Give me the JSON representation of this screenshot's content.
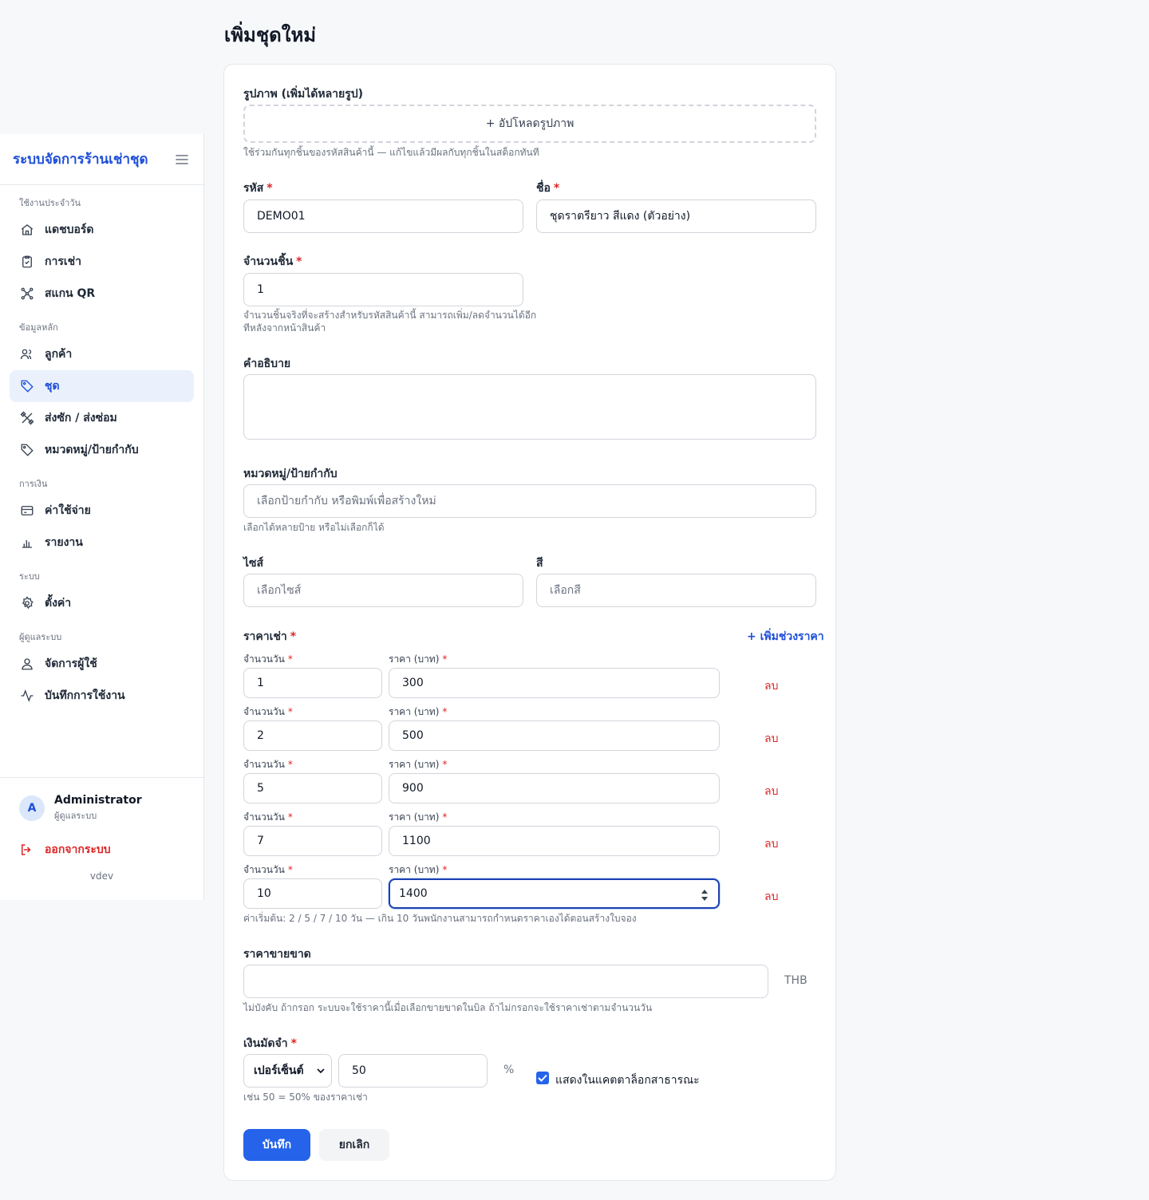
{
  "page": {
    "title": "เพิ่มชุดใหม่"
  },
  "sidebar": {
    "brand": "ระบบจัดการร้านเช่าชุด",
    "sections": [
      {
        "label": "ใช้งานประจำวัน",
        "items": [
          "แดชบอร์ด",
          "การเช่า",
          "สแกน QR"
        ]
      },
      {
        "label": "ข้อมูลหลัก",
        "items": [
          "ลูกค้า",
          "ชุด",
          "ส่งซัก / ส่งซ่อม",
          "หมวดหมู่/ป้ายกำกับ"
        ]
      },
      {
        "label": "การเงิน",
        "items": [
          "ค่าใช้จ่าย",
          "รายงาน"
        ]
      },
      {
        "label": "ระบบ",
        "items": [
          "ตั้งค่า"
        ]
      },
      {
        "label": "ผู้ดูแลระบบ",
        "items": [
          "จัดการผู้ใช้",
          "บันทึกการใช้งาน"
        ]
      }
    ],
    "active_item": "ชุด",
    "user": {
      "initial": "A",
      "name": "Administrator",
      "role": "ผู้ดูแลระบบ"
    },
    "logout": "ออกจากระบบ",
    "version": "vdev"
  },
  "form": {
    "images": {
      "label": "รูปภาพ (เพิ่มได้หลายรูป)",
      "upload_button": "+ อัปโหลดรูปภาพ",
      "hint": "ใช้ร่วมกันทุกชิ้นของรหัสสินค้านี้ — แก้ไขแล้วมีผลกับทุกชิ้นในสต็อกทันที"
    },
    "code": {
      "label": "รหัส",
      "value": "DEMO01"
    },
    "name": {
      "label": "ชื่อ",
      "value": "ชุดราตรียาว สีแดง (ตัวอย่าง)"
    },
    "quantity": {
      "label": "จำนวนชิ้น",
      "value": "1",
      "hint_line1": "จำนวนชิ้นจริงที่จะสร้างสำหรับรหัสสินค้านี้ สามารถเพิ่ม/ลดจำนวนได้อีก",
      "hint_line2": "ทีหลังจากหน้าสินค้า"
    },
    "description": {
      "label": "คำอธิบาย",
      "value": ""
    },
    "tags": {
      "label": "หมวดหมู่/ป้ายกำกับ",
      "placeholder": "เลือกป้ายกำกับ หรือพิมพ์เพื่อสร้างใหม่",
      "hint": "เลือกได้หลายป้าย หรือไม่เลือกก็ได้"
    },
    "size": {
      "label": "ไซส์",
      "placeholder": "เลือกไซส์"
    },
    "color": {
      "label": "สี",
      "placeholder": "เลือกสี"
    },
    "rental_price": {
      "label": "ราคาเช่า",
      "add_button": "+ เพิ่มช่วงราคา",
      "days_label": "จำนวนวัน",
      "price_label": "ราคา (บาท)",
      "delete_label": "ลบ",
      "tiers": [
        {
          "days": "1",
          "price": "300"
        },
        {
          "days": "2",
          "price": "500"
        },
        {
          "days": "5",
          "price": "900"
        },
        {
          "days": "7",
          "price": "1100"
        },
        {
          "days": "10",
          "price": "1400"
        }
      ],
      "hint": "ค่าเริ่มต้น: 2 / 5 / 7 / 10 วัน — เกิน 10 วันพนักงานสามารถกำหนดราคาเองได้ตอนสร้างใบจอง"
    },
    "sale_price": {
      "label": "ราคาขายขาด",
      "value": "",
      "currency": "THB",
      "hint": "ไม่บังคับ ถ้ากรอก ระบบจะใช้ราคานี้เมื่อเลือกขายขาดในบิล ถ้าไม่กรอกจะใช้ราคาเช่าตามจำนวนวัน"
    },
    "deposit": {
      "label": "เงินมัดจำ",
      "type": "เปอร์เซ็นต์",
      "value": "50",
      "unit": "%",
      "hint": "เช่น 50 = 50% ของราคาเช่า"
    },
    "public_catalog": {
      "label": "แสดงในแคตตาล็อกสาธารณะ",
      "checked": true
    },
    "save_button": "บันทึก",
    "cancel_button": "ยกเลิก"
  },
  "colors": {
    "accent": "#2563eb",
    "brand": "#1d4ed8",
    "danger": "#dc2626"
  }
}
